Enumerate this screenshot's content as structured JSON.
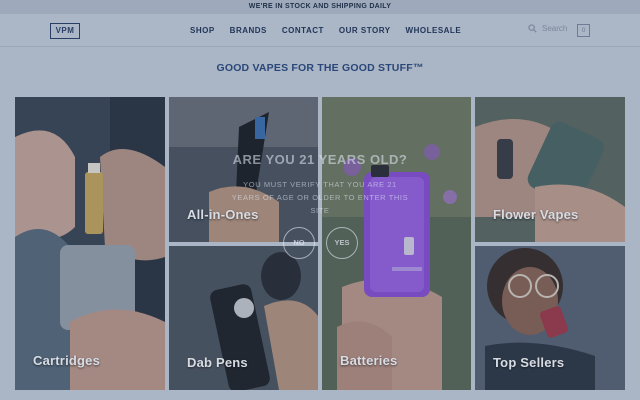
{
  "announcement": "WE'RE IN STOCK AND SHIPPING DAILY",
  "header": {
    "logo": "VPM",
    "nav": [
      "SHOP",
      "BRANDS",
      "CONTACT",
      "OUR STORY",
      "WHOLESALE"
    ],
    "search_label": "Search",
    "cart_count": "0"
  },
  "headline": "GOOD VAPES FOR THE GOOD STUFF™",
  "tiles": {
    "cartridges": "Cartridges",
    "all_in_ones": "All-in-Ones",
    "flower_vapes": "Flower Vapes",
    "dab_pens": "Dab Pens",
    "batteries": "Batteries",
    "top_sellers": "Top Sellers"
  },
  "age_gate": {
    "question": "ARE YOU 21 YEARS OLD?",
    "line1": "YOU MUST VERIFY THAT YOU ARE 21",
    "line2": "YEARS OF AGE OR OLDER TO ENTER THIS",
    "line3": "SITE",
    "no": "NO",
    "yes": "YES"
  },
  "colors": {
    "accent_navy": "#2b4a7f",
    "background": "#c7d0dc",
    "purple_device": "#8a4fd6"
  }
}
